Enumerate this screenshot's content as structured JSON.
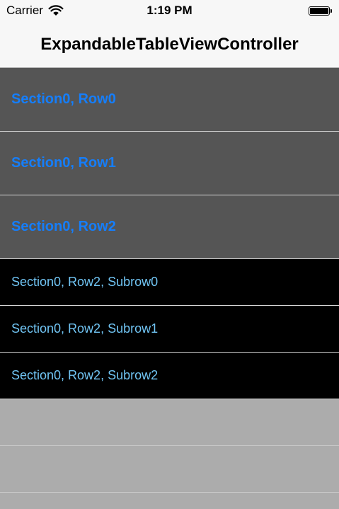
{
  "status_bar": {
    "carrier": "Carrier",
    "time": "1:19 PM"
  },
  "nav_bar": {
    "title": "ExpandableTableViewController"
  },
  "table": {
    "rows": [
      {
        "label": "Section0, Row0"
      },
      {
        "label": "Section0, Row1"
      },
      {
        "label": "Section0, Row2"
      }
    ],
    "subrows": [
      {
        "label": "Section0, Row2, Subrow0"
      },
      {
        "label": "Section0, Row2, Subrow1"
      },
      {
        "label": "Section0, Row2, Subrow2"
      }
    ]
  },
  "colors": {
    "row_background": "#555555",
    "row_text": "#157efb",
    "subrow_background": "#000000",
    "subrow_text": "#71c5f4",
    "empty_background": "#acacac"
  }
}
